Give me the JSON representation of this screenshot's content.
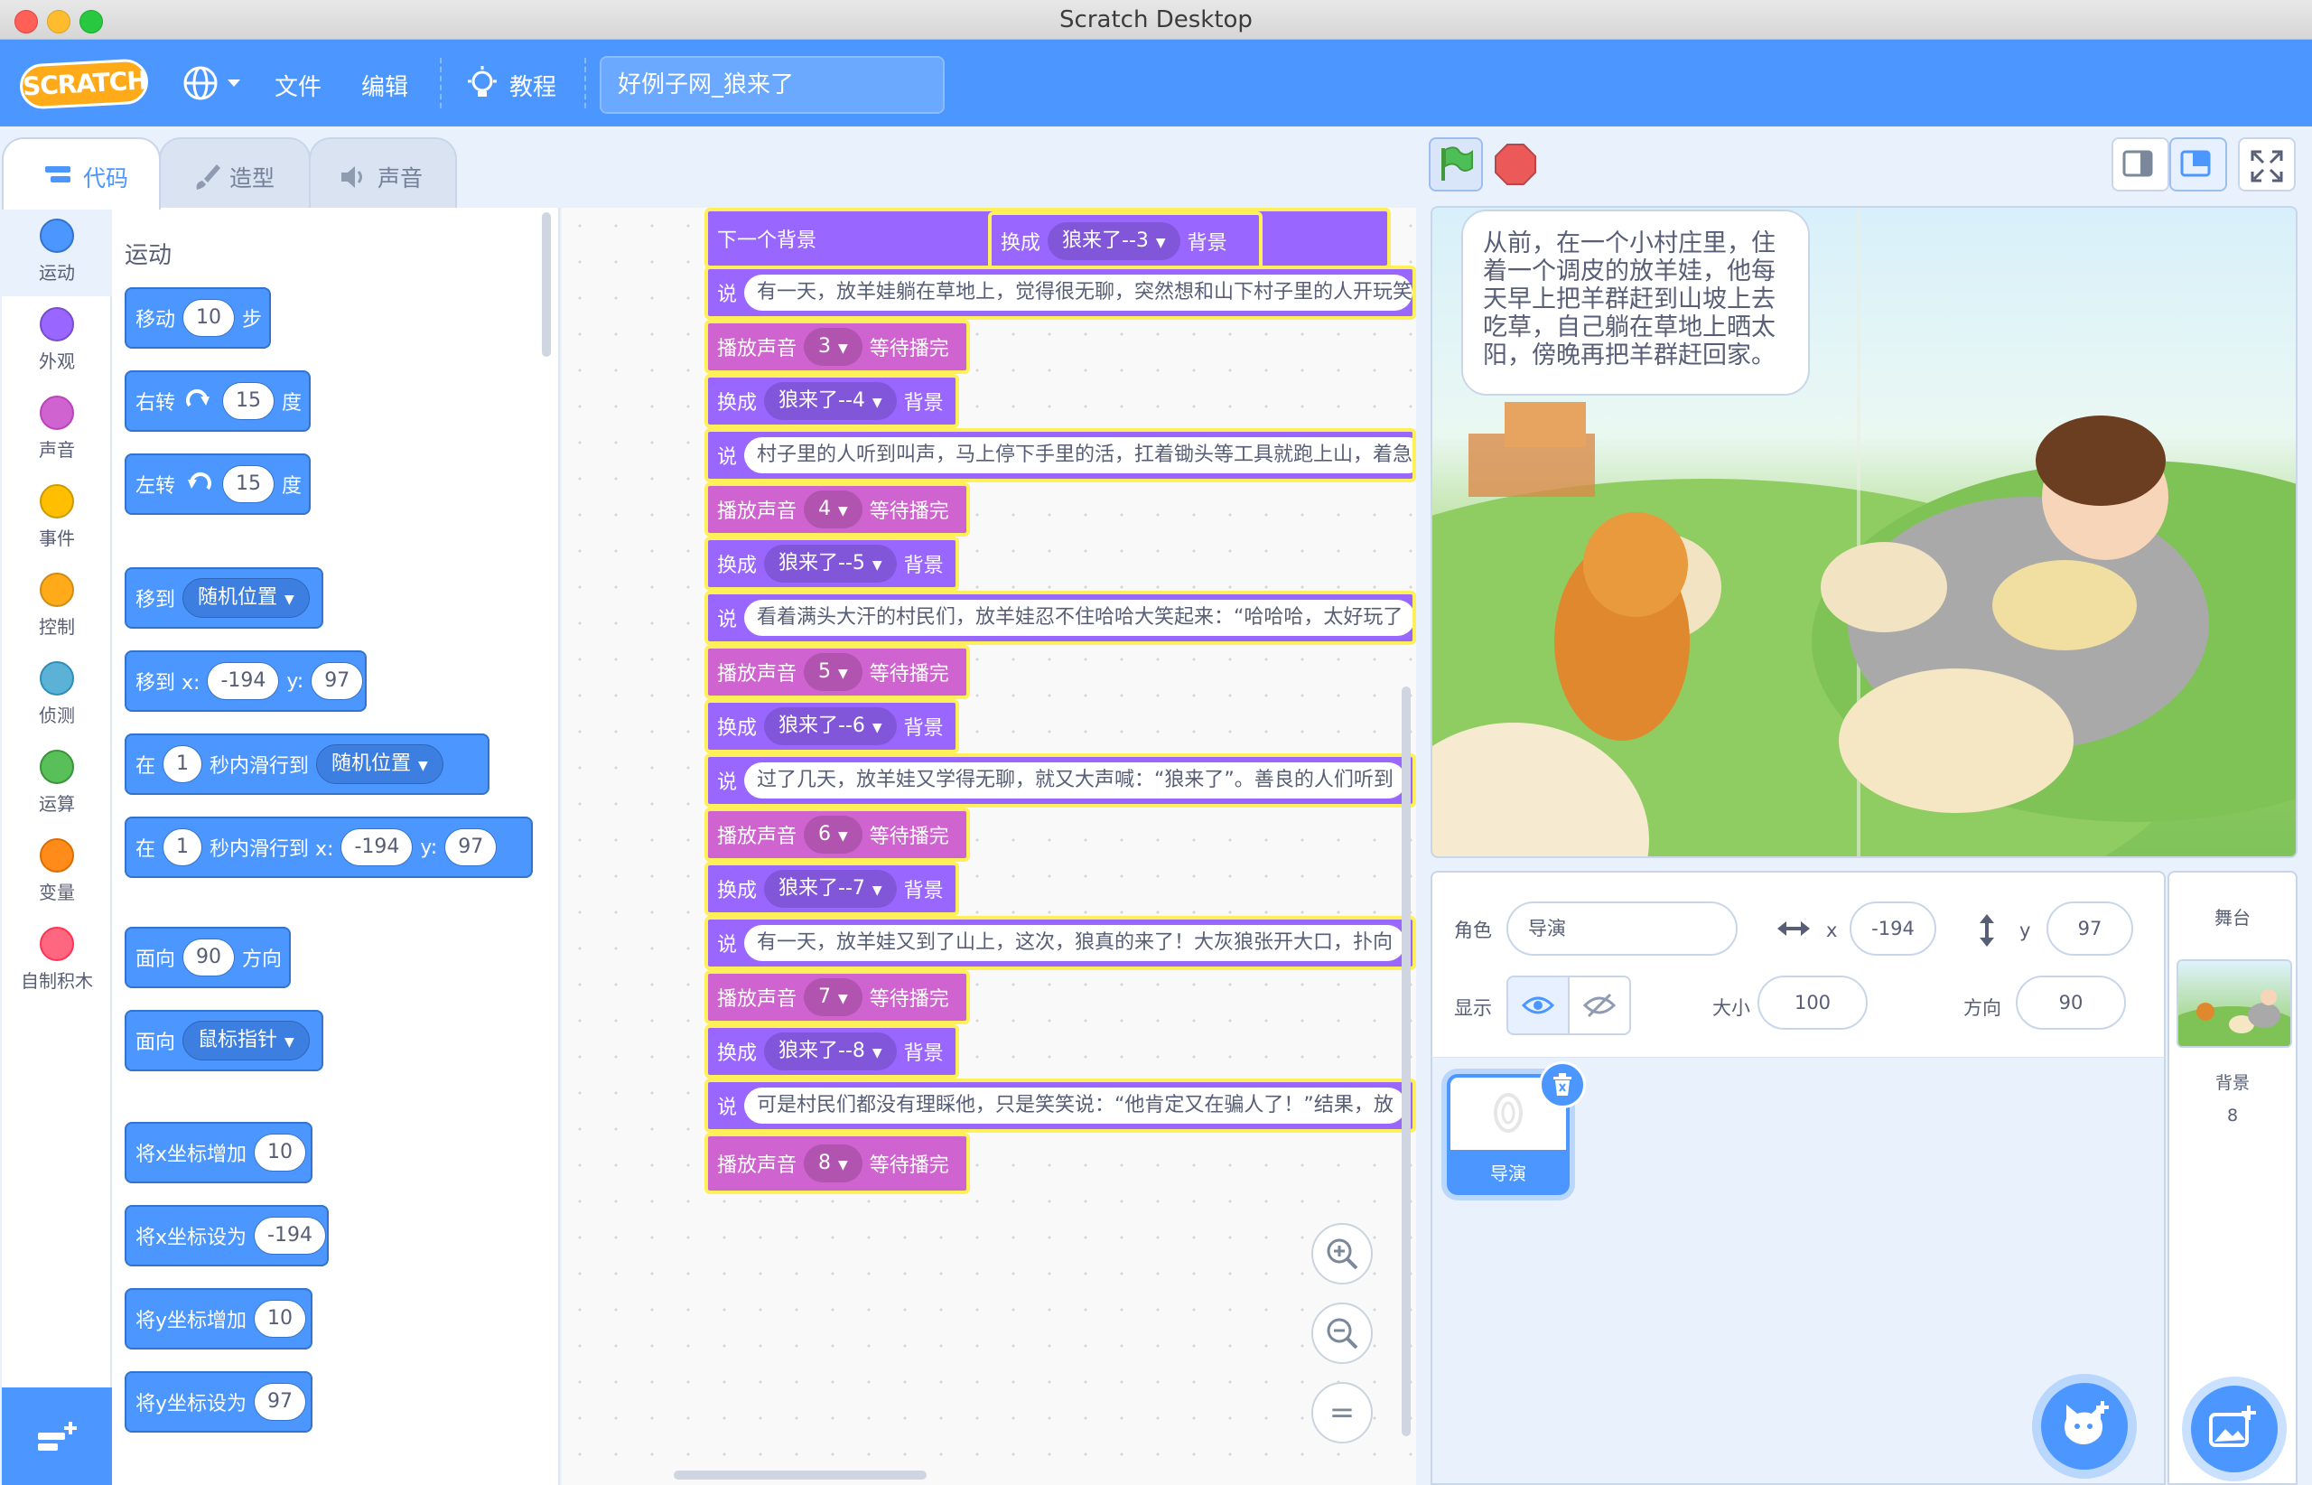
{
  "window": {
    "title": "Scratch Desktop"
  },
  "menubar": {
    "logo": "SCRATCH",
    "file": "文件",
    "edit": "编辑",
    "tutorials": "教程",
    "project_title": "好例子网_狼来了"
  },
  "tabs": {
    "code": "代码",
    "costumes": "造型",
    "sounds": "声音"
  },
  "categories": [
    {
      "label": "运动",
      "color": "#4c97ff"
    },
    {
      "label": "外观",
      "color": "#9966ff"
    },
    {
      "label": "声音",
      "color": "#cf63cf"
    },
    {
      "label": "事件",
      "color": "#ffbf00"
    },
    {
      "label": "控制",
      "color": "#ffab19"
    },
    {
      "label": "侦测",
      "color": "#5cb1d6"
    },
    {
      "label": "运算",
      "color": "#59c059"
    },
    {
      "label": "变量",
      "color": "#ff8c1a"
    },
    {
      "label": "自制积木",
      "color": "#ff6680"
    }
  ],
  "palette": {
    "heading": "运动",
    "move": {
      "pre": "移动",
      "val": "10",
      "post": "步"
    },
    "turn_right": {
      "pre": "右转",
      "val": "15",
      "post": "度"
    },
    "turn_left": {
      "pre": "左转",
      "val": "15",
      "post": "度"
    },
    "goto": {
      "pre": "移到",
      "drop": "随机位置"
    },
    "goto_xy": {
      "pre": "移到 x:",
      "x": "-194",
      "ylabel": "y:",
      "y": "97"
    },
    "glide": {
      "pre": "在",
      "val": "1",
      "mid": "秒内滑行到",
      "drop": "随机位置"
    },
    "glide_xy": {
      "pre": "在",
      "val": "1",
      "mid": "秒内滑行到 x:",
      "x": "-194",
      "ylabel": "y:",
      "y": "97"
    },
    "point_dir": {
      "pre": "面向",
      "val": "90",
      "post": "方向"
    },
    "point_toward": {
      "pre": "面向",
      "drop": "鼠标指针"
    },
    "change_x": {
      "pre": "将x坐标增加",
      "val": "10"
    },
    "set_x": {
      "pre": "将x坐标设为",
      "val": "-194"
    },
    "change_y": {
      "pre": "将y坐标增加",
      "val": "10"
    },
    "set_y": {
      "pre": "将y坐标设为",
      "val": "97"
    }
  },
  "script": {
    "next_backdrop": "下一个背景",
    "switch_label": "换成",
    "backdrop_label": "背景",
    "say_label": "说",
    "play_label": "播放声音",
    "until_done": "等待播完",
    "floating_backdrop": "狼来了--3",
    "say1": "有一天，放羊娃躺在草地上，觉得很无聊，突然想和山下村子里的人开玩笑",
    "sound3": "3",
    "bd4": "狼来了--4",
    "say2": "村子里的人听到叫声，马上停下手里的活，扛着锄头等工具就跑上山，着急",
    "sound4": "4",
    "bd5": "狼来了--5",
    "say3": "看着满头大汗的村民们，放羊娃忍不住哈哈大笑起来：“哈哈哈，太好玩了",
    "sound5": "5",
    "bd6": "狼来了--6",
    "say4": "过了几天，放羊娃又学得无聊，就又大声喊：“狼来了”。善良的人们听到",
    "sound6": "6",
    "bd7": "狼来了--7",
    "say5": "有一天，放羊娃又到了山上，这次，狼真的来了！大灰狼张开大口，扑向",
    "sound7": "7",
    "bd8": "狼来了--8",
    "say6": "可是村民们都没有理睬他，只是笑笑说：“他肯定又在骗人了！”结果，放",
    "sound8": "8"
  },
  "zoom": {
    "reset": "="
  },
  "stage": {
    "speech": "从前，在一个小村庄里，住着一个调皮的放羊娃，他每天早上把羊群赶到山坡上去吃草，自己躺在草地上晒太阳，傍晚再把羊群赶回家。"
  },
  "sprite_info": {
    "sprite_label": "角色",
    "sprite_name": "导演",
    "x_label": "x",
    "x": "-194",
    "y_label": "y",
    "y": "97",
    "show_label": "显示",
    "size_label": "大小",
    "size": "100",
    "direction_label": "方向",
    "direction": "90"
  },
  "sprites": [
    {
      "name": "导演"
    }
  ],
  "stage_panel": {
    "title": "舞台",
    "backdrop_label": "背景",
    "backdrop_count": "8"
  }
}
